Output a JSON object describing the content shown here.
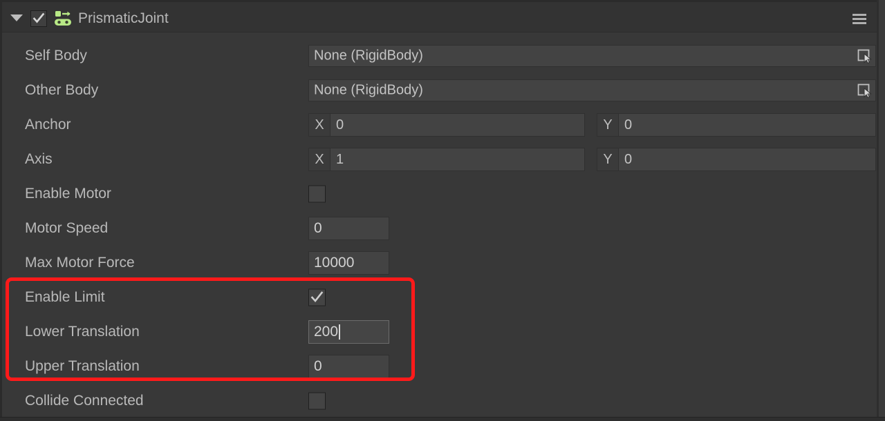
{
  "header": {
    "title": "PrismaticJoint",
    "enabled": true,
    "expanded": true,
    "foldout_icon": "triangle-down-icon",
    "component_icon": "prismatic-joint-icon",
    "component_icon_color": "#b8e986",
    "menu_icon": "hamburger-menu-icon"
  },
  "rows": [
    {
      "label": "Self Body",
      "type": "object",
      "value": "None (RigidBody)",
      "picker_icon": "object-picker-icon"
    },
    {
      "label": "Other Body",
      "type": "object",
      "value": "None (RigidBody)",
      "picker_icon": "object-picker-icon"
    },
    {
      "label": "Anchor",
      "type": "vector2",
      "x_tag": "X",
      "x_value": "0",
      "y_tag": "Y",
      "y_value": "0"
    },
    {
      "label": "Axis",
      "type": "vector2",
      "x_tag": "X",
      "x_value": "1",
      "y_tag": "Y",
      "y_value": "0"
    },
    {
      "label": "Enable Motor",
      "type": "checkbox",
      "checked": false
    },
    {
      "label": "Motor Speed",
      "type": "number",
      "value": "0",
      "focused": false
    },
    {
      "label": "Max Motor Force",
      "type": "number",
      "value": "10000",
      "focused": false
    },
    {
      "label": "Enable Limit",
      "type": "checkbox",
      "checked": true
    },
    {
      "label": "Lower Translation",
      "type": "number",
      "value": "200",
      "focused": true
    },
    {
      "label": "Upper Translation",
      "type": "number",
      "value": "0",
      "focused": false
    },
    {
      "label": "Collide Connected",
      "type": "checkbox",
      "checked": false
    }
  ],
  "annotation": {
    "color": "#ff1a1a",
    "covers": [
      "Enable Limit",
      "Lower Translation",
      "Upper Translation"
    ]
  },
  "colors": {
    "panel_bg": "#383838",
    "header_bg": "#333333",
    "field_bg": "#434343",
    "text": "#b9b9b9",
    "value_text": "#c4c4c4",
    "accent_icon": "#b8e986",
    "highlight": "#ff1a1a"
  }
}
